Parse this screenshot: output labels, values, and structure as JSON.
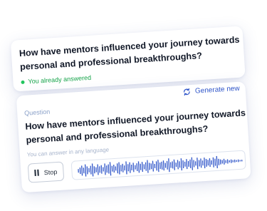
{
  "answered_card": {
    "question": "How have mentors influenced your journey towards personal and professional breakthroughs?",
    "status": "You already answered",
    "status_color": "#16a34a"
  },
  "question_card": {
    "generate_label": "Generate new",
    "section_label": "Question",
    "question": "How have mentors influenced your journey towards personal and professional breakthroughs?",
    "language_hint": "You can answer in any language",
    "stop_label": "Stop",
    "accent_color": "#2f55c9",
    "waveform_levels": [
      0.25,
      0.45,
      0.7,
      0.4,
      0.85,
      0.55,
      0.3,
      0.6,
      0.9,
      0.5,
      0.35,
      0.75,
      0.45,
      0.6,
      0.3,
      0.8,
      0.5,
      0.65,
      0.95,
      0.4,
      0.55,
      0.3,
      0.7,
      0.85,
      0.45,
      0.6,
      0.35,
      0.9,
      0.5,
      0.75,
      0.4,
      0.65,
      0.3,
      0.55,
      0.8,
      0.45,
      0.7,
      0.35,
      0.6,
      0.9,
      0.5,
      0.4,
      0.75,
      0.3,
      0.65,
      0.85,
      0.45,
      0.55,
      0.7,
      0.35,
      0.6,
      0.95,
      0.4,
      0.5,
      0.75,
      0.3,
      0.65,
      0.45,
      0.85,
      0.55,
      0.35,
      0.7,
      0.4,
      0.6,
      0.9,
      0.5,
      0.3,
      0.8,
      0.45,
      0.65,
      0.35,
      0.75,
      0.55,
      0.4,
      0.6,
      0.3,
      0.7,
      0.5,
      0.85,
      0.45,
      0.35,
      0.25,
      0.4,
      0.2,
      0.3,
      0.15,
      0.25,
      0.15,
      0.2,
      0.12,
      0.18,
      0.1,
      0.12
    ]
  }
}
